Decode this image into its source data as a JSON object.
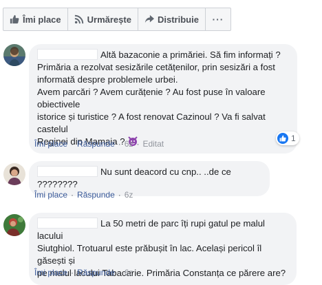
{
  "actions": {
    "like_label": "Îmi place",
    "follow_label": "Urmărește",
    "share_label": "Distribuie",
    "more_label": "···"
  },
  "colors": {
    "bubble_bg": "#f2f3f5",
    "link": "#385898",
    "meta_gray": "#606770",
    "like_blue": "#1877f2",
    "emoji_purple": "#8e44ad"
  },
  "comments": [
    {
      "lines": [
        "Altă bazaconie a primăriei. Să fim informați ?",
        "Primăria a rezolvat sesizările cetățenilor, prin sesizări a fost",
        "informată despre problemele urbei.",
        "Avem parcări ? Avem curățenie ? Au fost puse în valoare obiectivele",
        "istorice și turistice ? A fost renovat Cazinoul ? Va fi salvat castelul",
        "Reginei din Mamaia ?"
      ],
      "emoji": "devil-emoji-icon",
      "like_label": "Îmi place",
      "reply_label": "Răspunde",
      "time": "6z",
      "edited": "Editat",
      "reaction_count": "1"
    },
    {
      "lines": [
        "Nu sunt deacord cu cnp.. ..de ce ????????"
      ],
      "like_label": "Îmi place",
      "reply_label": "Răspunde",
      "time": "6z"
    },
    {
      "lines": [
        "La 50 metri de parc îți rupi gatul pe malul lacului",
        "Siutghiol. Trotuarul este prăbușit în lac. Același pericol îl găsești și",
        "pe malul lacului Tabacarie. Primăria Constanța ce părere are?"
      ],
      "like_label": "Îmi place",
      "reply_label": "Răspunde",
      "time": "6z"
    }
  ]
}
